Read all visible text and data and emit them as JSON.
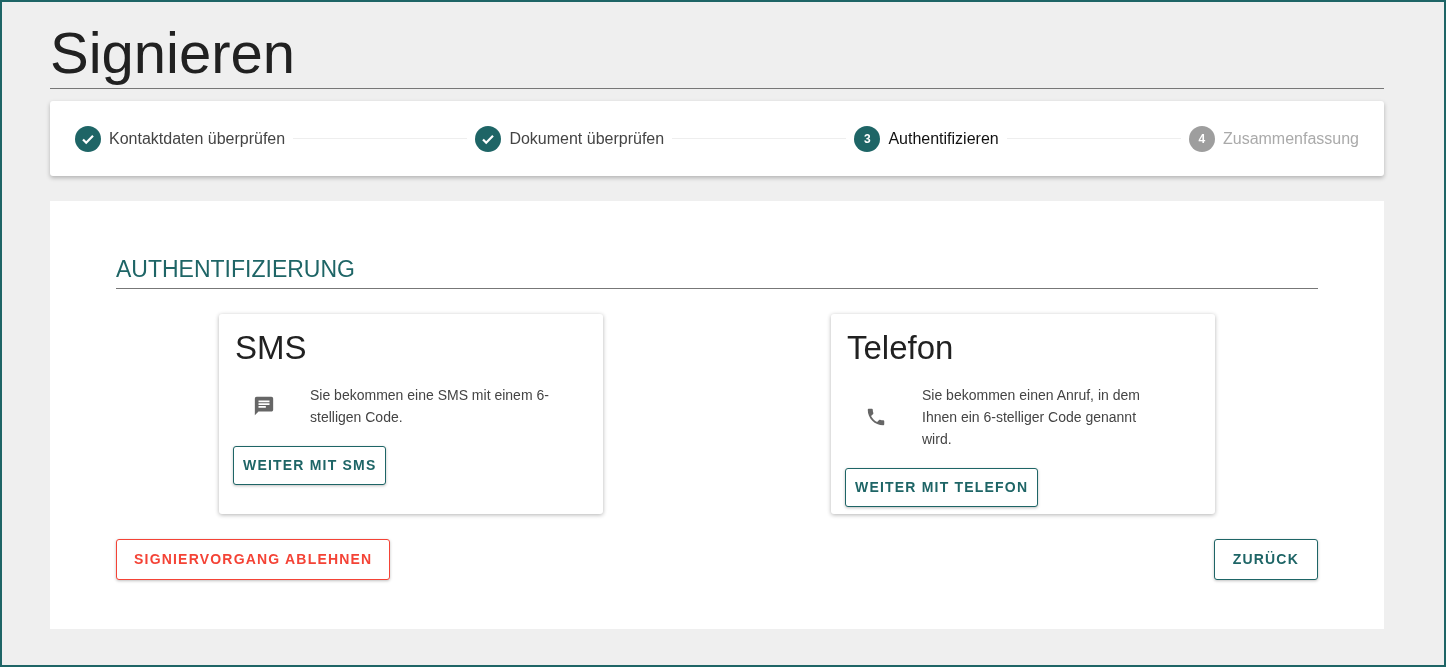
{
  "page": {
    "title": "Signieren"
  },
  "stepper": [
    {
      "label": "Kontaktdaten überprüfen",
      "completed": true,
      "selected": false
    },
    {
      "label": "Dokument überprüfen",
      "completed": true,
      "selected": false
    },
    {
      "label": "Authentifizieren",
      "completed": false,
      "selected": true,
      "number": "3"
    },
    {
      "label": "Zusammenfassung",
      "completed": false,
      "selected": false,
      "number": "4"
    }
  ],
  "section": {
    "heading": "AUTHENTIFIZIERUNG"
  },
  "methods": [
    {
      "kind": "sms",
      "title": "SMS",
      "description": "Sie bekommen eine SMS mit einem 6-stelligen Code.",
      "button": "WEITER MIT SMS"
    },
    {
      "kind": "phone",
      "title": "Telefon",
      "description": "Sie bekommen einen Anruf, in dem Ihnen ein 6-stelliger Code genannt wird.",
      "button": "WEITER MIT TELEFON"
    }
  ],
  "actions": {
    "decline": "SIGNIERVORGANG ABLEHNEN",
    "back": "ZURÜCK"
  }
}
